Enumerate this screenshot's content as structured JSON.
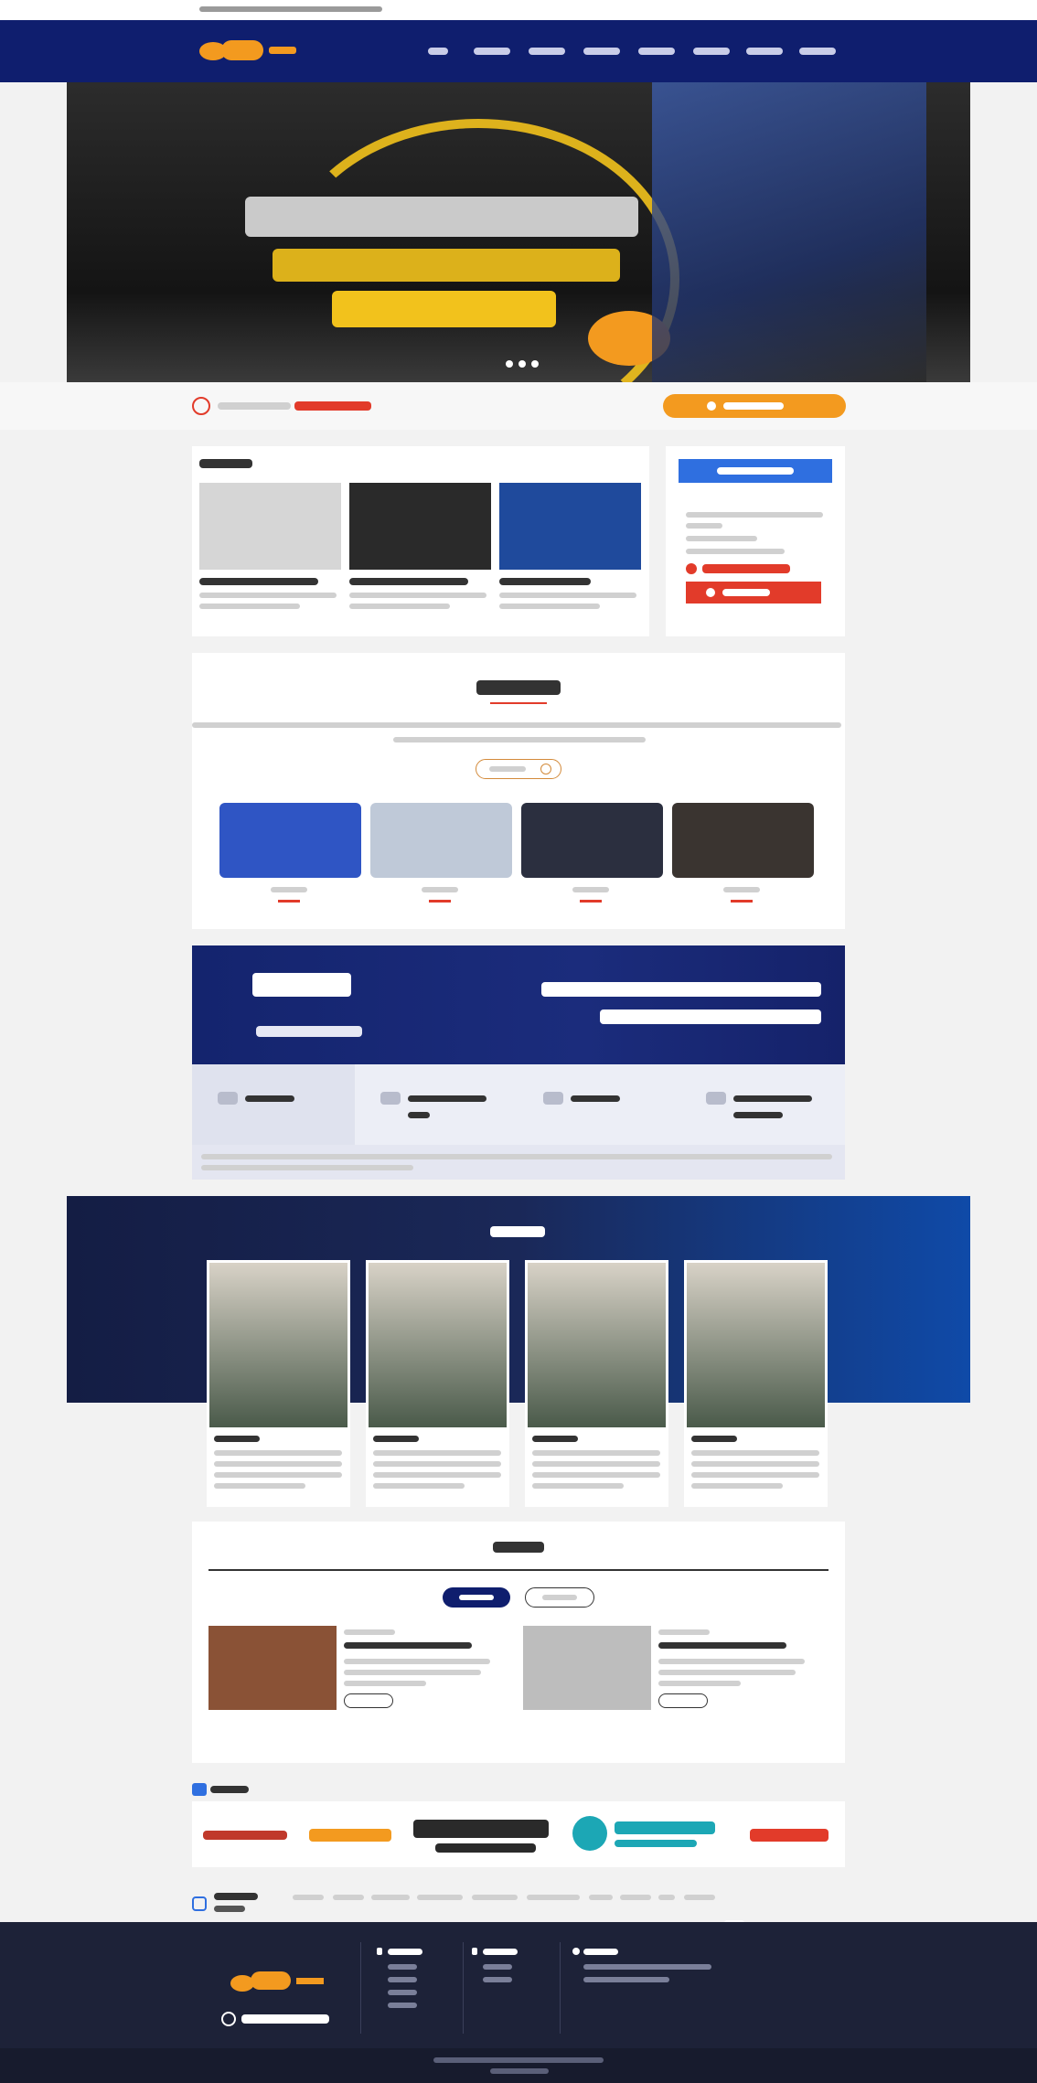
{
  "colors": {
    "navy": "#0f1e6e",
    "orange": "#f39a1f",
    "red": "#e23b2a",
    "blue": "#2f6fe0",
    "footer": "#1d2238",
    "footer_bottom": "#171b2d"
  }
}
